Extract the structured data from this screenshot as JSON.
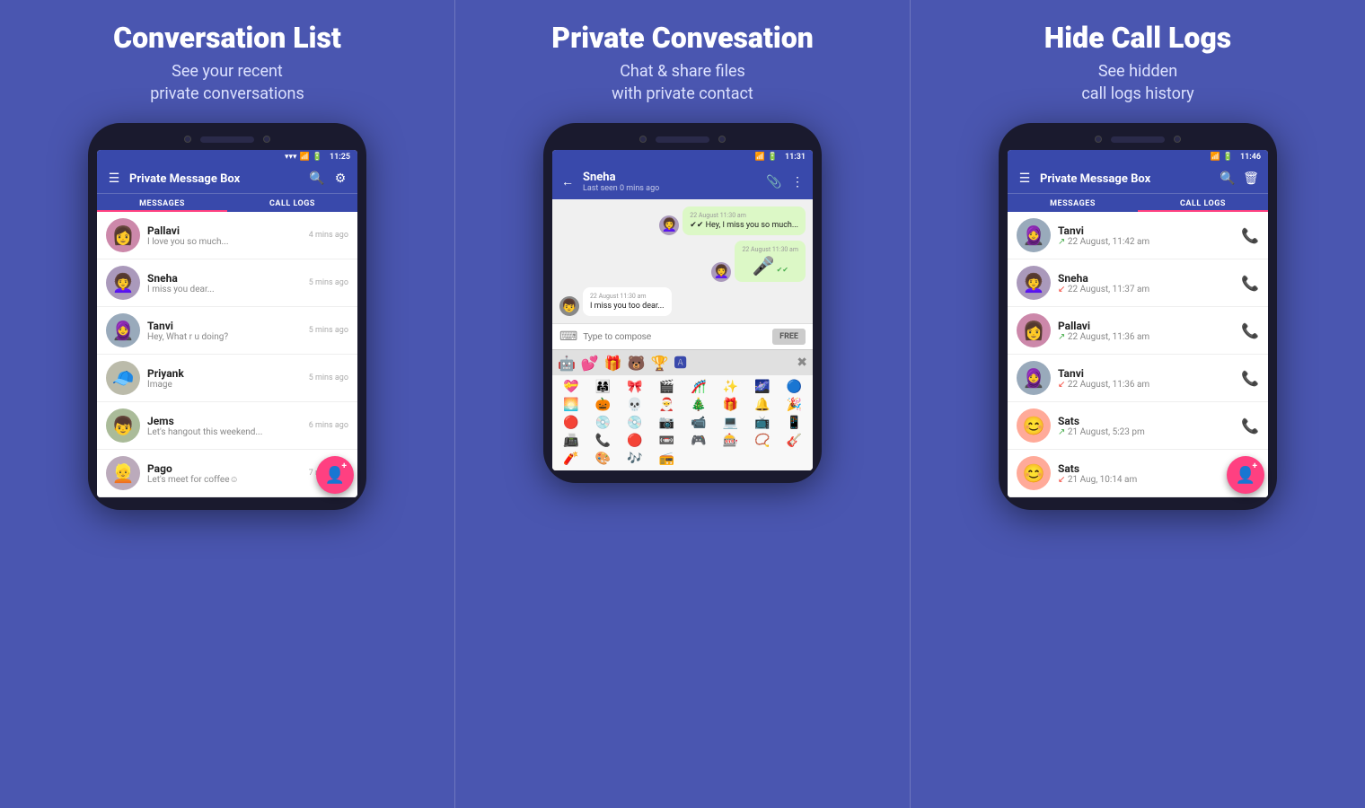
{
  "panels": [
    {
      "id": "conversation-list",
      "title": "Conversation List",
      "subtitle": "See your recent\nprivate conversations",
      "phone": {
        "time": "11:25",
        "app_bar": {
          "title": "Private Message Box",
          "icons": [
            "☰",
            "🔍",
            "⚙"
          ]
        },
        "tabs": [
          "MESSAGES",
          "CALL LOGS"
        ],
        "active_tab": 0,
        "conversations": [
          {
            "name": "Pallavi",
            "preview": "I love you so much...",
            "time": "4 mins ago",
            "avatar": "👩"
          },
          {
            "name": "Sneha",
            "preview": "I miss you dear...",
            "time": "5 mins ago",
            "avatar": "👩‍🦱"
          },
          {
            "name": "Tanvi",
            "preview": "Hey, What r u doing?",
            "time": "5 mins ago",
            "avatar": "🧕"
          },
          {
            "name": "Priyank",
            "preview": "Image",
            "time": "5 mins ago",
            "avatar": "🧢"
          },
          {
            "name": "Jems",
            "preview": "Let's hangout this weekend...",
            "time": "6 mins ago",
            "avatar": "👦"
          },
          {
            "name": "Pago",
            "preview": "Let's meet for coffee☺",
            "time": "7 mins ago",
            "avatar": "👱"
          }
        ],
        "fab_icon": "👤+"
      }
    },
    {
      "id": "private-conversation",
      "title": "Private Convesation",
      "subtitle": "Chat & share files\nwith private contact",
      "phone": {
        "time": "11:31",
        "chat": {
          "contact_name": "Sneha",
          "contact_status": "Last seen 0 mins ago",
          "messages": [
            {
              "type": "outgoing",
              "time": "22 August 11:30 am",
              "text": "Hey, I miss you so much...",
              "has_avatar": true
            },
            {
              "type": "outgoing",
              "time": "22 August 11:30 am",
              "text": "🎤",
              "is_audio": true,
              "has_avatar": true
            },
            {
              "type": "incoming",
              "time": "22 August 11:30 am",
              "text": "I miss you too dear...",
              "has_avatar": true
            }
          ],
          "compose_placeholder": "Type to compose",
          "compose_btn": "FREE"
        },
        "emoji_tabs": [
          "🤖",
          "💕",
          "🎁",
          "🐻",
          "🏆",
          "🅰",
          "✖"
        ],
        "emojis": [
          "💝",
          "👨‍👩‍👧",
          "🎀",
          "🎬",
          "🎢",
          "✨",
          "🌌",
          "🔵",
          "🌅",
          "🎃",
          "💀",
          "🎅",
          "🎄",
          "🎁",
          "🔔",
          "🎉",
          "🔴",
          "💿",
          "💿",
          "📷",
          "📹",
          "💻",
          "📺",
          "📱",
          "📠",
          "📞",
          "🔴",
          "📼",
          "🎮",
          "🎰",
          "📿",
          "🎸",
          "🧨",
          "🎨",
          "🎶",
          "📻"
        ]
      }
    },
    {
      "id": "hide-call-logs",
      "title": "Hide Call Logs",
      "subtitle": "See hidden\ncall logs history",
      "phone": {
        "time": "11:46",
        "app_bar": {
          "title": "Private Message Box",
          "icons": [
            "☰",
            "🔍",
            "🗑"
          ]
        },
        "tabs": [
          "MESSAGES",
          "CALL LOGS"
        ],
        "active_tab": 1,
        "call_logs": [
          {
            "name": "Tanvi",
            "time": "22 August, 11:42 am",
            "type": "outgoing",
            "avatar": "🧕"
          },
          {
            "name": "Sneha",
            "time": "22 August, 11:37 am",
            "type": "incoming",
            "avatar": "👩‍🦱"
          },
          {
            "name": "Pallavi",
            "time": "22 August, 11:36 am",
            "type": "outgoing",
            "avatar": "👩"
          },
          {
            "name": "Tanvi",
            "time": "22 August, 11:36 am",
            "type": "missed",
            "avatar": "🧕"
          },
          {
            "name": "Sats",
            "time": "21 August, 5:23 pm",
            "type": "outgoing",
            "avatar": "😊"
          },
          {
            "name": "Sats",
            "time": "21 Aug, 10:14 am",
            "type": "missed",
            "avatar": "😊"
          }
        ],
        "fab_icon": "👤+"
      }
    }
  ]
}
